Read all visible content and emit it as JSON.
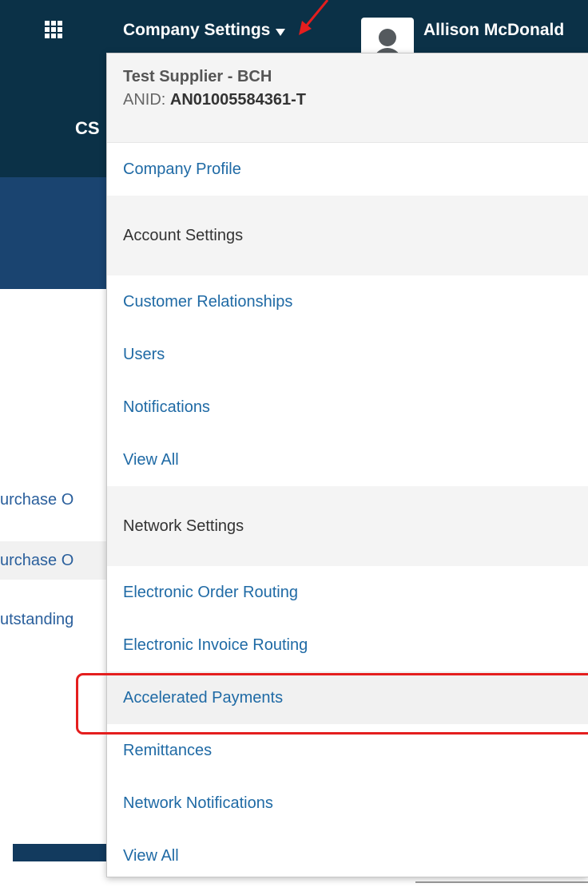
{
  "topbar": {
    "company_settings_label": "Company Settings",
    "user_name": "Allison McDonald"
  },
  "background": {
    "cs_partial": "CS",
    "rows": [
      "urchase O",
      "urchase O",
      "utstanding"
    ]
  },
  "dropdown": {
    "company_name": "Test Supplier - BCH",
    "anid_label": "ANID:",
    "anid_value": "AN01005584361-T",
    "company_profile": "Company Profile",
    "account_settings": {
      "heading": "Account Settings",
      "items": [
        "Customer Relationships",
        "Users",
        "Notifications",
        "View All"
      ]
    },
    "network_settings": {
      "heading": "Network Settings",
      "items": [
        "Electronic Order Routing",
        "Electronic Invoice Routing",
        "Accelerated Payments",
        "Remittances",
        "Network Notifications",
        "View All"
      ]
    },
    "highlighted_item": "Accelerated Payments"
  },
  "colors": {
    "topbar_bg": "#0b3147",
    "link_blue": "#1f6aa5",
    "annotation_red": "#e41e1e"
  },
  "icons": [
    "apps-grid-icon",
    "caret-down-icon",
    "user-avatar-icon",
    "annotation-arrow-icon"
  ]
}
